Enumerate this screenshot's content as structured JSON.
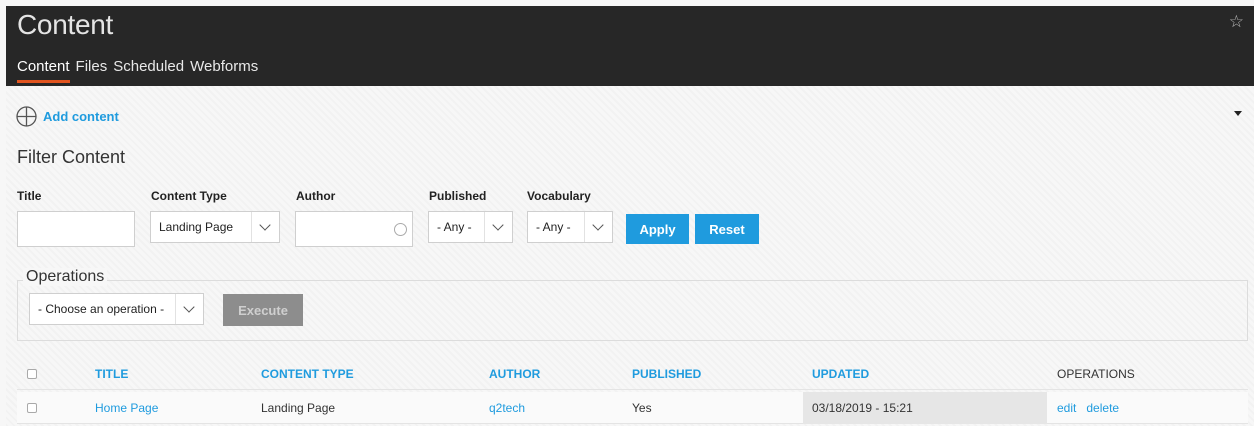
{
  "header": {
    "title": "Content",
    "tabs": [
      {
        "label": "Content",
        "active": true
      },
      {
        "label": "Files",
        "active": false
      },
      {
        "label": "Scheduled",
        "active": false
      },
      {
        "label": "Webforms",
        "active": false
      }
    ],
    "bookmark_icon": "star-outline-icon"
  },
  "actions": {
    "add_content_label": "Add content",
    "add_icon": "circle-plus-icon"
  },
  "filter": {
    "heading": "Filter Content",
    "title_label": "Title",
    "title_value": "",
    "content_type_label": "Content Type",
    "content_type_value": "Landing Page",
    "author_label": "Author",
    "author_value": "",
    "published_label": "Published",
    "published_value": "- Any -",
    "vocabulary_label": "Vocabulary",
    "vocabulary_value": "- Any -",
    "apply_label": "Apply",
    "reset_label": "Reset"
  },
  "operations": {
    "legend": "Operations",
    "select_value": "- Choose an operation -",
    "execute_label": "Execute"
  },
  "table": {
    "columns": [
      "TITLE",
      "CONTENT TYPE",
      "AUTHOR",
      "PUBLISHED",
      "UPDATED",
      "OPERATIONS"
    ],
    "rows": [
      {
        "title": "Home Page",
        "content_type": "Landing Page",
        "author": "q2tech",
        "published": "Yes",
        "updated": "03/18/2019 - 15:21",
        "edit": "edit",
        "delete": "delete"
      }
    ]
  },
  "colors": {
    "accent": "#1f9bde",
    "tab_underline": "#e1541f",
    "header_bg": "#272727"
  }
}
